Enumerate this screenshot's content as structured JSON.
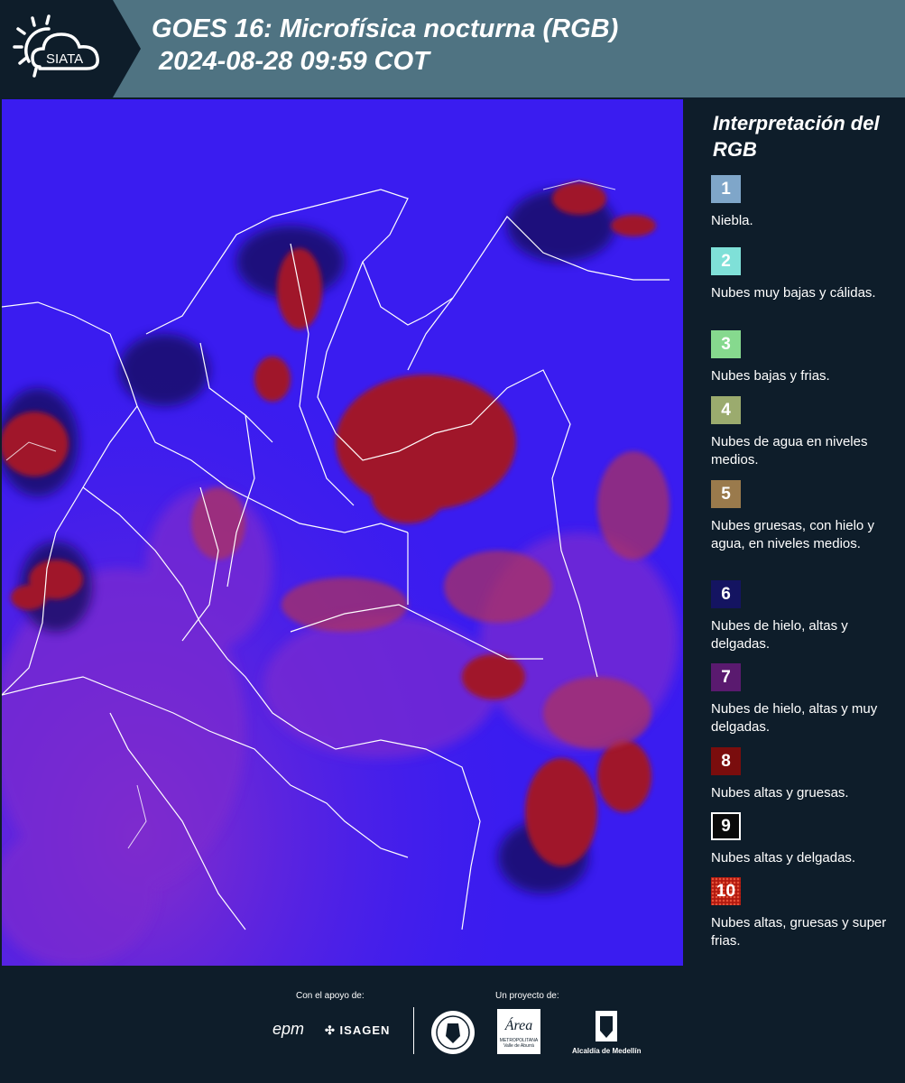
{
  "header": {
    "logo_text": "SIATA",
    "title_line1": "GOES 16: Microfísica nocturna (RGB)",
    "title_line2": " 2024-08-28 09:59 COT"
  },
  "map": {
    "background_color": "#3a1cf0",
    "cloud_color": "#9a1c3c",
    "border_color": "#ffffff"
  },
  "legend": {
    "title": "Interpretación del RGB",
    "items": [
      {
        "number": "1",
        "color": "#7fa6c9",
        "label": "Niebla."
      },
      {
        "number": "2",
        "color": "#7fe0d8",
        "label": "Nubes muy bajas y cálidas."
      },
      {
        "number": "3",
        "color": "#86d98e",
        "label": "Nubes bajas y frias."
      },
      {
        "number": "4",
        "color": "#9bab6e",
        "label": "Nubes de agua en niveles medios."
      },
      {
        "number": "5",
        "color": "#9a7a4c",
        "label": "Nubes gruesas, con hielo y agua, en niveles medios."
      },
      {
        "number": "6",
        "color": "#141461",
        "label": "Nubes de hielo, altas y delgadas."
      },
      {
        "number": "7",
        "color": "#5a1a6f",
        "label": "Nubes de hielo, altas y muy delgadas."
      },
      {
        "number": "8",
        "color": "#7a0d0d",
        "label": "Nubes altas y gruesas."
      },
      {
        "number": "9",
        "color": "#0a0a0a",
        "label": "Nubes altas y delgadas."
      },
      {
        "number": "10",
        "color": "#b1190f",
        "label": "Nubes altas, gruesas y super frias."
      }
    ]
  },
  "footer": {
    "support_label": "Con el apoyo de:",
    "project_label": "Un proyecto de:",
    "epm_text": "epm",
    "isagen_text": "ISAGEN",
    "area_text": "Área",
    "area_sub": "METROPOLITANA",
    "area_sub2": "Valle de Aburrá",
    "alcaldia_text": "Alcaldía de Medellín"
  }
}
